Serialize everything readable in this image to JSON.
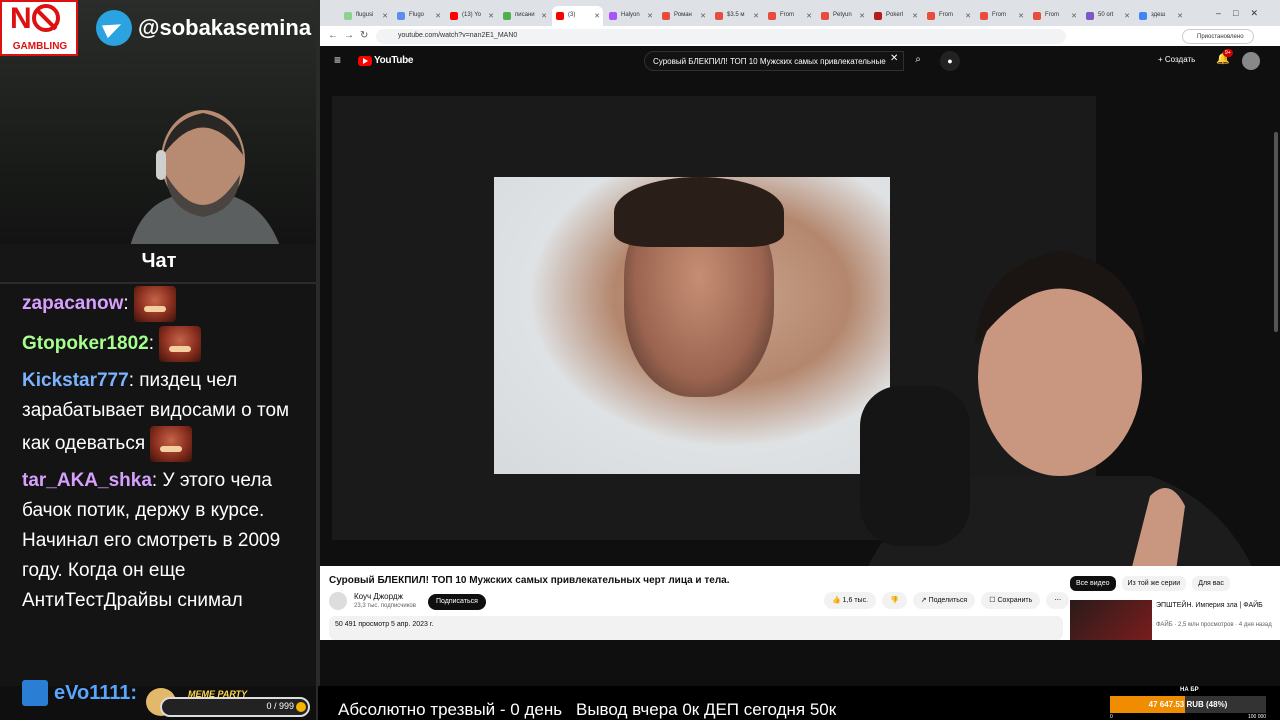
{
  "stream": {
    "logo_text": "GAMBLING",
    "telegram_handle": "@sobakasemina",
    "chat_title": "Чат",
    "messages": [
      {
        "user": "zapacanow",
        "user_color": "#d7a0ff",
        "text": "",
        "emote": true
      },
      {
        "user": "Gtopoker1802",
        "user_color": "#a6ff8c",
        "text": "",
        "emote": true
      },
      {
        "user": "Kickstar777",
        "user_color": "#7bb3ff",
        "text": "пиздец чел зарабатывает видосами о том как одеваться",
        "emote": true
      },
      {
        "user": "tar_AKA_shka",
        "user_color": "#d7a0ff",
        "text": "У этого чела бачок потик, держу в курсе. Начинал его смотреть в 2009 году. Когда он еще АнтиТестДрайвы снимал",
        "emote": false
      }
    ],
    "last_user": "eVo1111:",
    "meme_party_label": "MEME PARTY",
    "meme_party_count": "0 / 999"
  },
  "browser": {
    "tabs": [
      {
        "label": "flugusi",
        "color": "#8fd18f",
        "active": false
      },
      {
        "label": "Flugo",
        "color": "#5b8def",
        "active": false
      },
      {
        "label": "(13) Yo",
        "color": "#ff0000",
        "active": false
      },
      {
        "label": "писани",
        "color": "#4caf50",
        "active": false
      },
      {
        "label": "(3)",
        "color": "#ff0000",
        "active": true
      },
      {
        "label": "Halyon",
        "color": "#a855f7",
        "active": false
      },
      {
        "label": "Роман",
        "color": "#e74c3c",
        "active": false
      },
      {
        "label": "$3.5 м",
        "color": "#e74c3c",
        "active": false
      },
      {
        "label": "From",
        "color": "#e74c3c",
        "active": false
      },
      {
        "label": "Petyun",
        "color": "#e74c3c",
        "active": false
      },
      {
        "label": "Pokerl",
        "color": "#b71c1c",
        "active": false
      },
      {
        "label": "From",
        "color": "#e74c3c",
        "active": false
      },
      {
        "label": "From",
        "color": "#e74c3c",
        "active": false
      },
      {
        "label": "From",
        "color": "#e74c3c",
        "active": false
      },
      {
        "label": "50 ort",
        "color": "#7e57c2",
        "active": false
      },
      {
        "label": "здеш",
        "color": "#4285f4",
        "active": false
      }
    ],
    "url": "youtube.com/watch?v=nan2E1_MAN0",
    "profile_label": "Приостановлено"
  },
  "youtube": {
    "logo": "YouTube",
    "search_query": "Суровый БЛЕКПИЛ! ТОП 10 Мужских самых привлекательные",
    "create_label": "Создать",
    "notif_count": "9+",
    "video_title": "Суровый БЛЕКПИЛ! ТОП 10 Мужских самых привлекательных черт лица и тела.",
    "channel_name": "Коуч Джордж",
    "channel_subs": "23,3 тыс. подписчиков",
    "subscribe_label": "Подписаться",
    "likes": "1,6 тыс.",
    "share_label": "Поделиться",
    "save_label": "Сохранить",
    "views_date": "50 491 просмотр  5 апр. 2023 г.",
    "chips": [
      "Все видео",
      "Из той же серии",
      "Для вас"
    ],
    "rec_title": "ЭПШТЕЙН. Империя зла | ФАЙБ",
    "rec_channel": "ФАЙБ",
    "rec_meta": "2,5 млн просмотров · 4 дня назад"
  },
  "overlay": {
    "sober_text": "Абсолютно трезвый - 0 день",
    "withdraw_text": "Вывод вчера 0к  ДЕП сегодня 50к",
    "na_br": "НА БР",
    "balance_text": "47 647.53 RUB (48%)",
    "balance_fraction": 0.48,
    "balance_min": "0",
    "balance_max": "100 000"
  }
}
